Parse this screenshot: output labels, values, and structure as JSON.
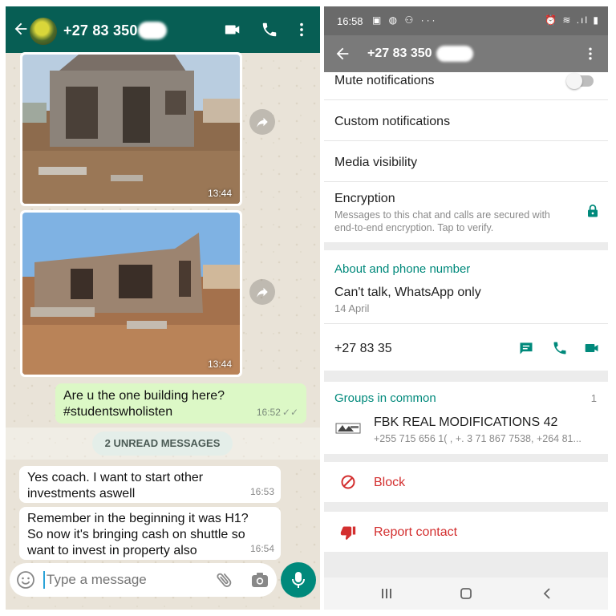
{
  "chat": {
    "contact_number": "+27 83 350",
    "images": [
      {
        "time": "13:44"
      },
      {
        "time": "13:44"
      }
    ],
    "outgoing": {
      "line1": "Are u the one building here?",
      "line2": "#studentswholisten",
      "time": "16:52",
      "ticks": "✓✓"
    },
    "unread_banner": "2 UNREAD MESSAGES",
    "incoming": [
      {
        "lines": [
          "Yes coach. I want to start other",
          "investments aswell"
        ],
        "time": "16:53"
      },
      {
        "lines": [
          "Remember in the beginning it was H1?",
          "So now it's bringing cash on shuttle so",
          "want to invest in property also"
        ],
        "time": "16:54"
      }
    ],
    "composer_placeholder": "Type a message"
  },
  "info": {
    "status_time": "16:58",
    "status_icons": "▣ ◍ ⚇ ···",
    "status_right": "⏰ ≋ .ıl ▮",
    "title": "+27 83 350",
    "mute_label": "Mute notifications",
    "custom_label": "Custom notifications",
    "media_label": "Media visibility",
    "encryption_label": "Encryption",
    "encryption_sub1": "Messages to this chat and calls are secured with",
    "encryption_sub2": "end-to-end encryption. Tap to verify.",
    "about_title": "About and phone number",
    "about_text": "Can't talk, WhatsApp only",
    "about_date": "14 April",
    "phone": "+27 83 35",
    "groups_title": "Groups in common",
    "groups_count": "1",
    "group_name": "FBK REAL MODIFICATIONS 42",
    "group_members": "+255 715 656 1(  , +.  3 71 867 7538, +264 81...",
    "block_label": "Block",
    "report_label": "Report contact"
  },
  "colors": {
    "header_teal": "#075e54",
    "accent_teal": "#00897b",
    "outgoing_bubble": "#dcf8c6",
    "danger": "#d32f2f"
  }
}
